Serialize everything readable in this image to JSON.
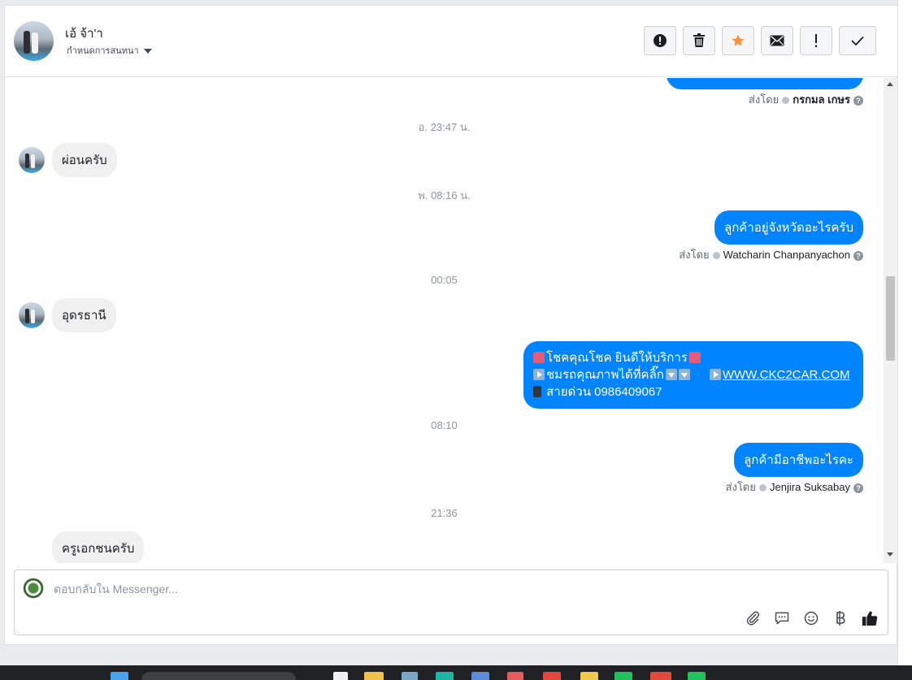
{
  "header": {
    "contact_name": "เอ้ จ้า'า",
    "contact_sub": "กำหนดการสนทนา"
  },
  "toolbar": {
    "buttons": [
      {
        "icon": "alert-circle-icon",
        "glyph": "!"
      },
      {
        "icon": "trash-icon",
        "glyph": "trash"
      },
      {
        "icon": "star-icon",
        "glyph": "★"
      },
      {
        "icon": "mail-icon",
        "glyph": "mail"
      },
      {
        "icon": "exclamation-icon",
        "glyph": "!"
      },
      {
        "icon": "check-icon",
        "glyph": "✓"
      }
    ]
  },
  "thread": {
    "sent_by_label": "ส่งโดย",
    "top_sender": "กรกมล เกษร",
    "items": {
      "ts1": "อ. 23:47 น.",
      "msg1": "ผ่อนครับ",
      "ts2": "พ. 08:16 น.",
      "msg2": "ลูกค้าอยู่จังหวัดอะไรครับ",
      "sender2": "Watcharin Chanpanyachon",
      "ts3": "00:05",
      "msg3": "อุดรธานี",
      "promo_line1": "โชคคุณโชค ยินดีให้บริการ",
      "promo_line2": "ชมรถคุณภาพได้ที่คลิ๊ก",
      "promo_link": "WWW.CKC2CAR.COM",
      "promo_line3": "สายด่วน 0986409067",
      "ts4": "08:10",
      "msg4": "ลูกค้ามีอาชีพอะไรคะ",
      "sender4": "Jenjira Suksabay",
      "ts5": "21:36",
      "msg5": "ครูเอกชนครับ"
    }
  },
  "composer": {
    "placeholder": "ตอบกลับใน Messenger..."
  },
  "colors": {
    "outgoing_bubble": "#0084ff",
    "incoming_bubble": "#f0f0f0",
    "star": "#f7923a"
  }
}
